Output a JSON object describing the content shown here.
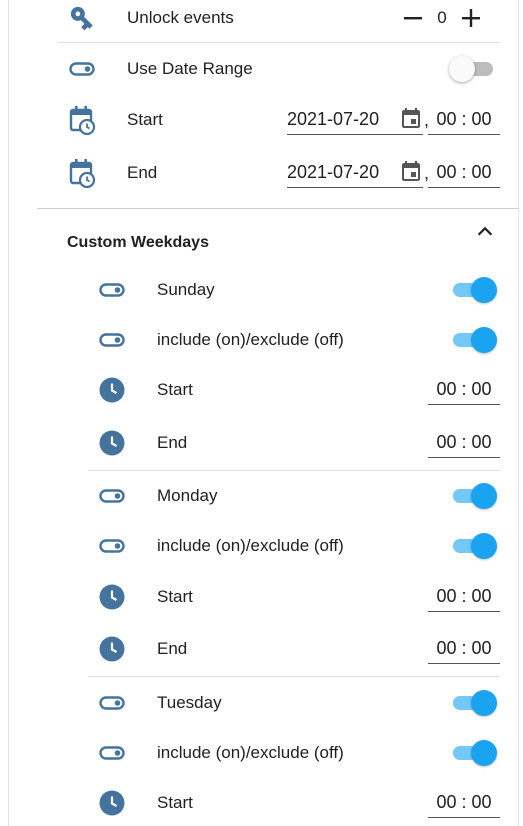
{
  "top": {
    "unlock_events": {
      "label": "Unlock events",
      "value": "0"
    },
    "use_date_range": {
      "label": "Use Date Range",
      "on": false
    },
    "start": {
      "label": "Start",
      "date": "2021-07-20",
      "time": "00 : 00"
    },
    "end": {
      "label": "End",
      "date": "2021-07-20",
      "time": "00 : 00"
    }
  },
  "custom_weekdays": {
    "title": "Custom Weekdays",
    "days": [
      {
        "name": "Sunday",
        "on": true,
        "include_label": "include (on)/exclude (off)",
        "include_on": true,
        "start_label": "Start",
        "start_time": "00 : 00",
        "end_label": "End",
        "end_time": "00 : 00"
      },
      {
        "name": "Monday",
        "on": true,
        "include_label": "include (on)/exclude (off)",
        "include_on": true,
        "start_label": "Start",
        "start_time": "00 : 00",
        "end_label": "End",
        "end_time": "00 : 00"
      },
      {
        "name": "Tuesday",
        "on": true,
        "include_label": "include (on)/exclude (off)",
        "include_on": true,
        "start_label": "Start",
        "start_time": "00 : 00"
      }
    ]
  },
  "colors": {
    "icon": "#44739e",
    "toggle_on_knob": "#1aa3f0",
    "toggle_on_track": "#72c9f7",
    "toggle_off_track": "#bdbdbd"
  },
  "icons": {
    "unlock_events": "key-icon",
    "use_date_range": "toggle-switch-icon",
    "start": "calendar-clock-icon",
    "end": "calendar-clock-icon",
    "date_picker": "calendar-icon",
    "collapse": "chevron-up-icon",
    "weekday_toggle": "toggle-switch-icon",
    "time": "clock-icon"
  }
}
